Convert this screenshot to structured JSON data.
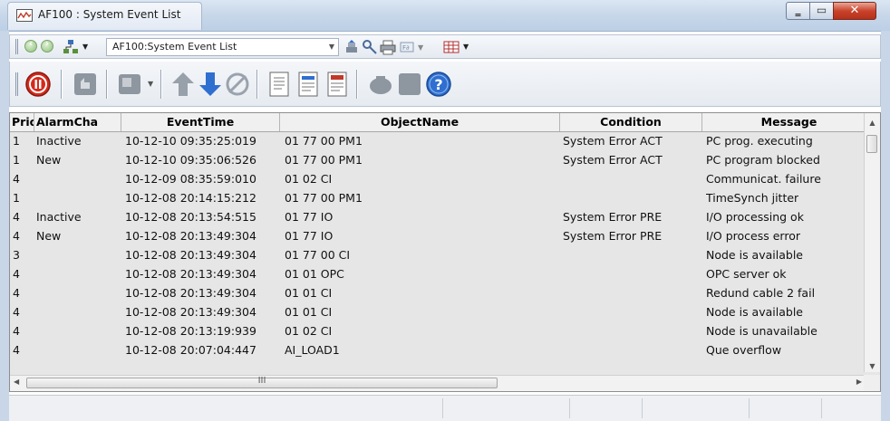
{
  "window": {
    "title": "AF100 : System Event List",
    "controls": {
      "minimize": "minimize-icon",
      "maximize": "maximize-icon",
      "close": "close-icon"
    }
  },
  "address_bar": {
    "value": "AF100:System Event List",
    "icons": [
      "back-icon",
      "forward-icon",
      "tree-icon",
      "stack-icon",
      "key-icon",
      "print-icon",
      "tag-icon",
      "grid-icon"
    ]
  },
  "toolbar": {
    "icons": [
      "stop-icon",
      "acknowledge-icon",
      "pages-icon",
      "arrow-up-icon",
      "arrow-down-icon",
      "clear-icon",
      "document-icon",
      "document-list-icon",
      "document-detail-icon",
      "alarm-icon",
      "block-icon",
      "help-icon"
    ]
  },
  "table": {
    "columns": [
      {
        "key": "prio",
        "label": "Prio"
      },
      {
        "key": "alarm",
        "label": "AlarmCha"
      },
      {
        "key": "time",
        "label": "EventTime"
      },
      {
        "key": "object",
        "label": "ObjectName"
      },
      {
        "key": "condition",
        "label": "Condition"
      },
      {
        "key": "message",
        "label": "Message"
      }
    ],
    "rows": [
      {
        "prio": "1",
        "alarm": "Inactive",
        "time": "10-12-10 09:35:25:019",
        "object": "01 77 00 PM1",
        "condition": "System Error ACT",
        "message": "PC prog. executing"
      },
      {
        "prio": "1",
        "alarm": "New",
        "time": "10-12-10 09:35:06:526",
        "object": "01 77 00 PM1",
        "condition": "System Error ACT",
        "message": "PC program blocked"
      },
      {
        "prio": "4",
        "alarm": "",
        "time": "10-12-09 08:35:59:010",
        "object": "01 02 CI",
        "condition": "",
        "message": "Communicat. failure"
      },
      {
        "prio": "1",
        "alarm": "",
        "time": "10-12-08 20:14:15:212",
        "object": "01 77 00 PM1",
        "condition": "",
        "message": "TimeSynch jitter"
      },
      {
        "prio": "4",
        "alarm": "Inactive",
        "time": "10-12-08 20:13:54:515",
        "object": "01 77 IO",
        "condition": "System Error PRE",
        "message": "I/O processing ok"
      },
      {
        "prio": "4",
        "alarm": "New",
        "time": "10-12-08 20:13:49:304",
        "object": "01 77 IO",
        "condition": "System Error PRE",
        "message": "I/O process error"
      },
      {
        "prio": "3",
        "alarm": "",
        "time": "10-12-08 20:13:49:304",
        "object": "01 77 00 CI",
        "condition": "",
        "message": "Node is available"
      },
      {
        "prio": "4",
        "alarm": "",
        "time": "10-12-08 20:13:49:304",
        "object": "01 01 OPC",
        "condition": "",
        "message": "OPC server ok"
      },
      {
        "prio": "4",
        "alarm": "",
        "time": "10-12-08 20:13:49:304",
        "object": "01 01 CI",
        "condition": "",
        "message": "Redund cable 2 fail"
      },
      {
        "prio": "4",
        "alarm": "",
        "time": "10-12-08 20:13:49:304",
        "object": "01 01 CI",
        "condition": "",
        "message": "Node is available"
      },
      {
        "prio": "4",
        "alarm": "",
        "time": "10-12-08 20:13:19:939",
        "object": "01 02 CI",
        "condition": "",
        "message": "Node is unavailable"
      },
      {
        "prio": "4",
        "alarm": "",
        "time": "10-12-08 20:07:04:447",
        "object": "AI_LOAD1",
        "condition": "",
        "message": "Que overflow"
      }
    ]
  },
  "scrollbar": {
    "grip": "III"
  },
  "colors": {
    "list_bg": "#e6e6e6",
    "header_bg": "#f0f0f0",
    "stop_red": "#d42a1c",
    "arrow_blue": "#2f6fd0",
    "help_blue": "#2f6fd0"
  }
}
